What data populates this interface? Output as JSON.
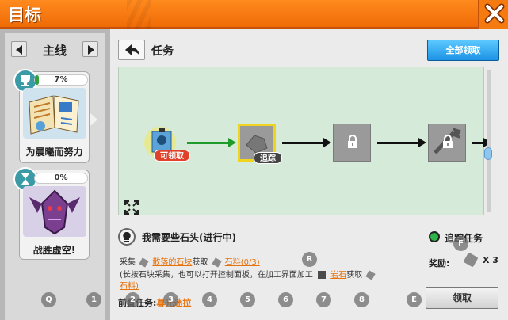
{
  "window": {
    "title": "目标"
  },
  "sidebar": {
    "nav_label": "主线",
    "cards": [
      {
        "name": "为晨曦而努力",
        "progress": 7,
        "progress_text": "7%"
      },
      {
        "name": "战胜虚空!",
        "progress": 0,
        "progress_text": "0%"
      }
    ]
  },
  "main": {
    "section_title": "任务",
    "claim_all_label": "全部领取",
    "nodes": [
      {
        "state": "claimable",
        "tag": "可领取"
      },
      {
        "state": "tracking",
        "tag": "追踪"
      },
      {
        "state": "locked"
      },
      {
        "state": "locked"
      }
    ],
    "quest": {
      "name": "我需要些石头(进行中)",
      "track_label": "追踪任务",
      "desc_line1": {
        "prefix": "采集",
        "item1": "散落的石块",
        "mid": "获取",
        "item2": "石料(0/3)"
      },
      "desc_line2": {
        "prefix": "(长按石块采集，也可以打开控制面板，在加工界面加工",
        "item1": "岩石",
        "mid": "获取",
        "tail": "石料)"
      },
      "reward_label": "奖励:",
      "reward_qty": "X 3",
      "prev_label": "前置任务:",
      "prev_value": "暮光迷拉",
      "claim_label": "领取"
    }
  },
  "hotkeys": [
    "Q",
    "1",
    "2",
    "3",
    "4",
    "5",
    "6",
    "7",
    "8",
    "E",
    "R",
    "F"
  ],
  "colors": {
    "accent": "#f47a0f",
    "claim_all": "#1c93e6",
    "progress": "#33a040",
    "highlight": "#e8710a"
  }
}
